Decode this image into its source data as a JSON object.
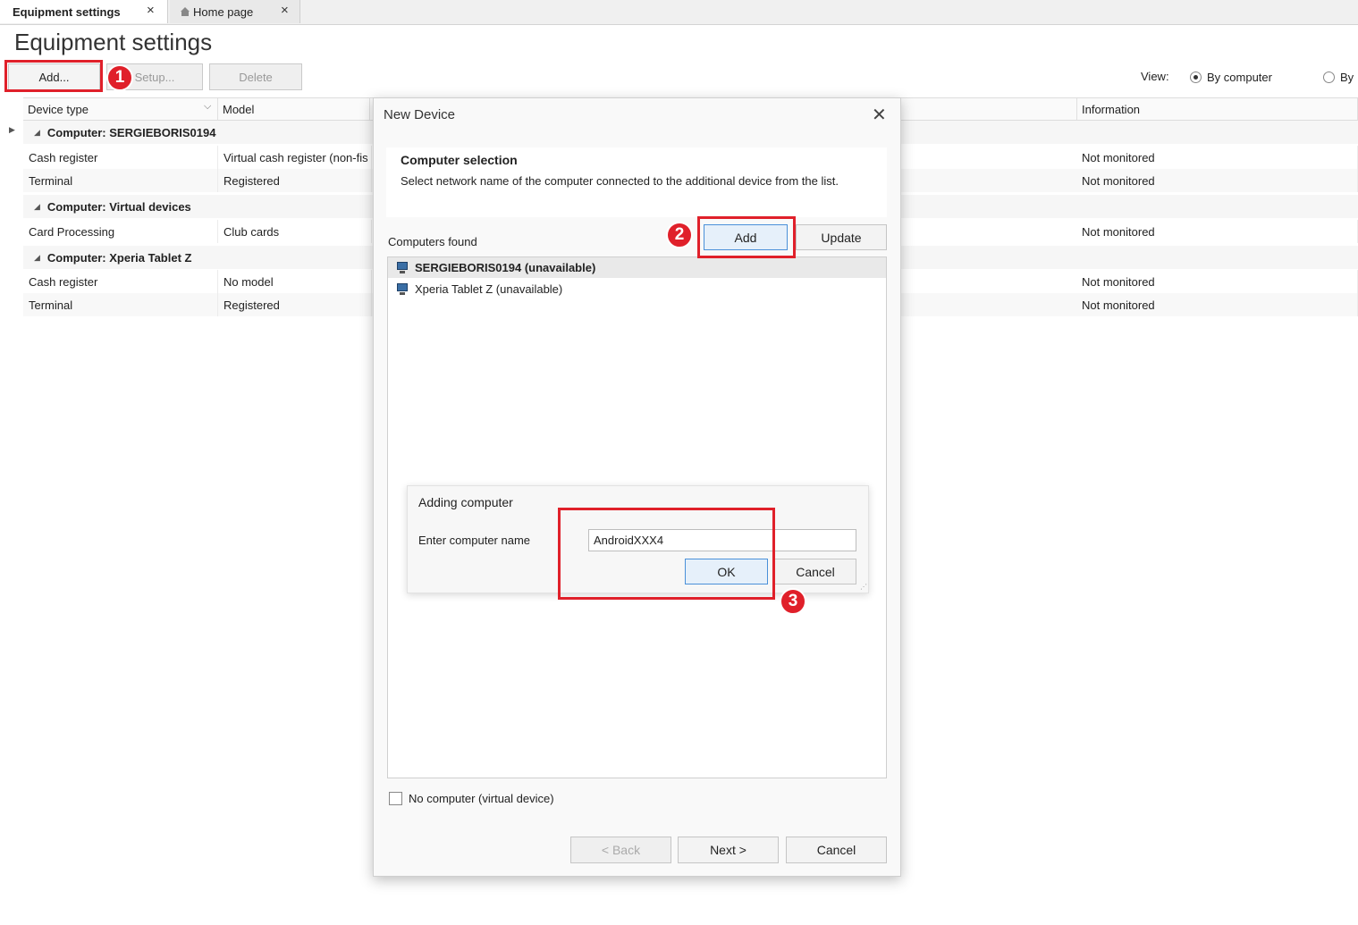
{
  "tabs": [
    {
      "label": "Equipment settings",
      "active": true
    },
    {
      "label": "Home page",
      "active": false
    }
  ],
  "page": {
    "title": "Equipment settings"
  },
  "toolbar": {
    "add_label": "Add...",
    "setup_label": "Setup...",
    "delete_label": "Delete"
  },
  "view": {
    "label": "View:",
    "options": [
      "By computer",
      "By"
    ],
    "selected": "By computer"
  },
  "grid": {
    "columns": [
      "Device type",
      "Model",
      "Information"
    ],
    "rows": [
      {
        "type": "group",
        "label": "Computer: SERGIEBORIS0194"
      },
      {
        "type": "item",
        "device": "Cash register",
        "model": "Virtual cash register (non-fis",
        "info": "Not monitored"
      },
      {
        "type": "item",
        "device": "Terminal",
        "model": "Registered",
        "info": "Not monitored"
      },
      {
        "type": "group",
        "label": "Computer: Virtual devices"
      },
      {
        "type": "item",
        "device": "Card Processing",
        "model": "Club cards",
        "info": "Not monitored"
      },
      {
        "type": "group",
        "label": "Computer: Xperia Tablet Z"
      },
      {
        "type": "item",
        "device": "Cash register",
        "model": "No model",
        "info": "Not monitored"
      },
      {
        "type": "item",
        "device": "Terminal",
        "model": "Registered",
        "info": "Not monitored"
      }
    ]
  },
  "dialog": {
    "title": "New Device",
    "section_title": "Computer selection",
    "section_desc": "Select network name of the computer connected to the additional device from the list.",
    "found_label": "Computers found",
    "add_label": "Add",
    "update_label": "Update",
    "computers": [
      {
        "name": "SERGIEBORIS0194 (unavailable)",
        "selected": true
      },
      {
        "name": "Xperia Tablet Z (unavailable)",
        "selected": false
      }
    ],
    "checkbox_label": "No computer (virtual device)",
    "back_label": "< Back",
    "next_label": "Next >",
    "cancel_label": "Cancel"
  },
  "sub_dialog": {
    "title": "Adding computer",
    "field_label": "Enter computer name",
    "field_value": "AndroidXXX4",
    "ok_label": "OK",
    "cancel_label": "Cancel"
  },
  "annotations": {
    "step1": "1",
    "step2": "2",
    "step3": "3",
    "color": "#e0202a"
  },
  "icons": {
    "tab_close": "×",
    "dialog_close": "✕",
    "expand": "▶",
    "collapse": "◢",
    "dropdown": "⌵"
  }
}
